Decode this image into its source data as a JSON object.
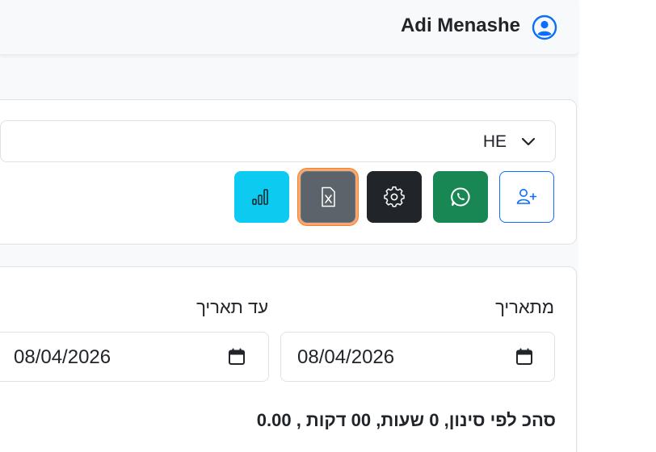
{
  "header": {
    "user_name": "Adi Menashe"
  },
  "language_select": {
    "value": "HE"
  },
  "toolbar": {
    "buttons": [
      {
        "name": "add-user",
        "icon": "person-plus-icon",
        "color": "#0d6efd"
      },
      {
        "name": "whatsapp",
        "icon": "whatsapp-icon",
        "color": "#198754"
      },
      {
        "name": "settings",
        "icon": "gear-icon",
        "color": "#212529"
      },
      {
        "name": "export-excel",
        "icon": "file-excel-icon",
        "color": "#5c636a"
      },
      {
        "name": "stats",
        "icon": "bar-chart-icon",
        "color": "#0dcaf0"
      }
    ]
  },
  "filters": {
    "from_label": "מתאריך",
    "to_label": "עד תאריך",
    "from_value": "08/04/2026",
    "to_value": "08/04/2026"
  },
  "summary": {
    "text": "סהכ לפי סינון, 0 שעות, 00 דקות , 0.00"
  },
  "colors": {
    "focus_ring": "#fd7e14",
    "primary": "#0d6efd"
  }
}
